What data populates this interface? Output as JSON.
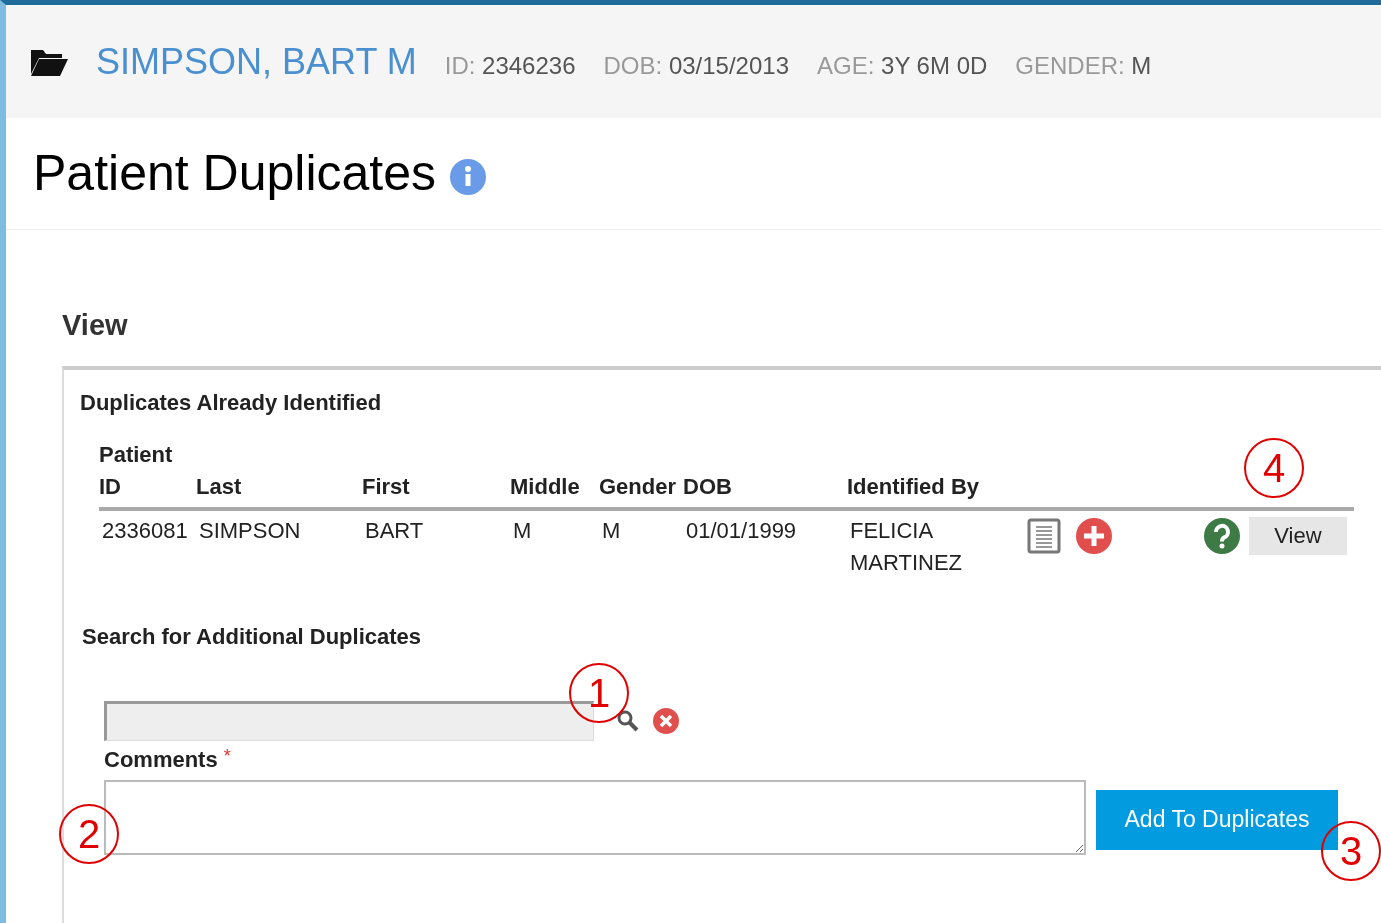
{
  "header": {
    "name": "SIMPSON, BART M",
    "fields": [
      {
        "label": "ID:",
        "value": "2346236"
      },
      {
        "label": "DOB:",
        "value": "03/15/2013"
      },
      {
        "label": "AGE:",
        "value": "3Y 6M 0D"
      },
      {
        "label": "GENDER:",
        "value": "M"
      }
    ]
  },
  "title": "Patient Duplicates",
  "section_title": "View",
  "identified": {
    "title": "Duplicates Already Identified",
    "columns": [
      "Patient ID",
      "Last",
      "First",
      "Middle",
      "Gender",
      "DOB",
      "Identified By"
    ],
    "rows": [
      {
        "cells": [
          "2336081",
          "SIMPSON",
          "BART",
          "M",
          "M",
          "01/01/1999",
          "FELICIA MARTINEZ"
        ],
        "action": "View"
      }
    ]
  },
  "search": {
    "title": "Search for Additional Duplicates"
  },
  "comments": {
    "label": "Comments",
    "required_mark": "*"
  },
  "add_button": "Add To Duplicates",
  "callouts": [
    "1",
    "2",
    "3",
    "4"
  ]
}
